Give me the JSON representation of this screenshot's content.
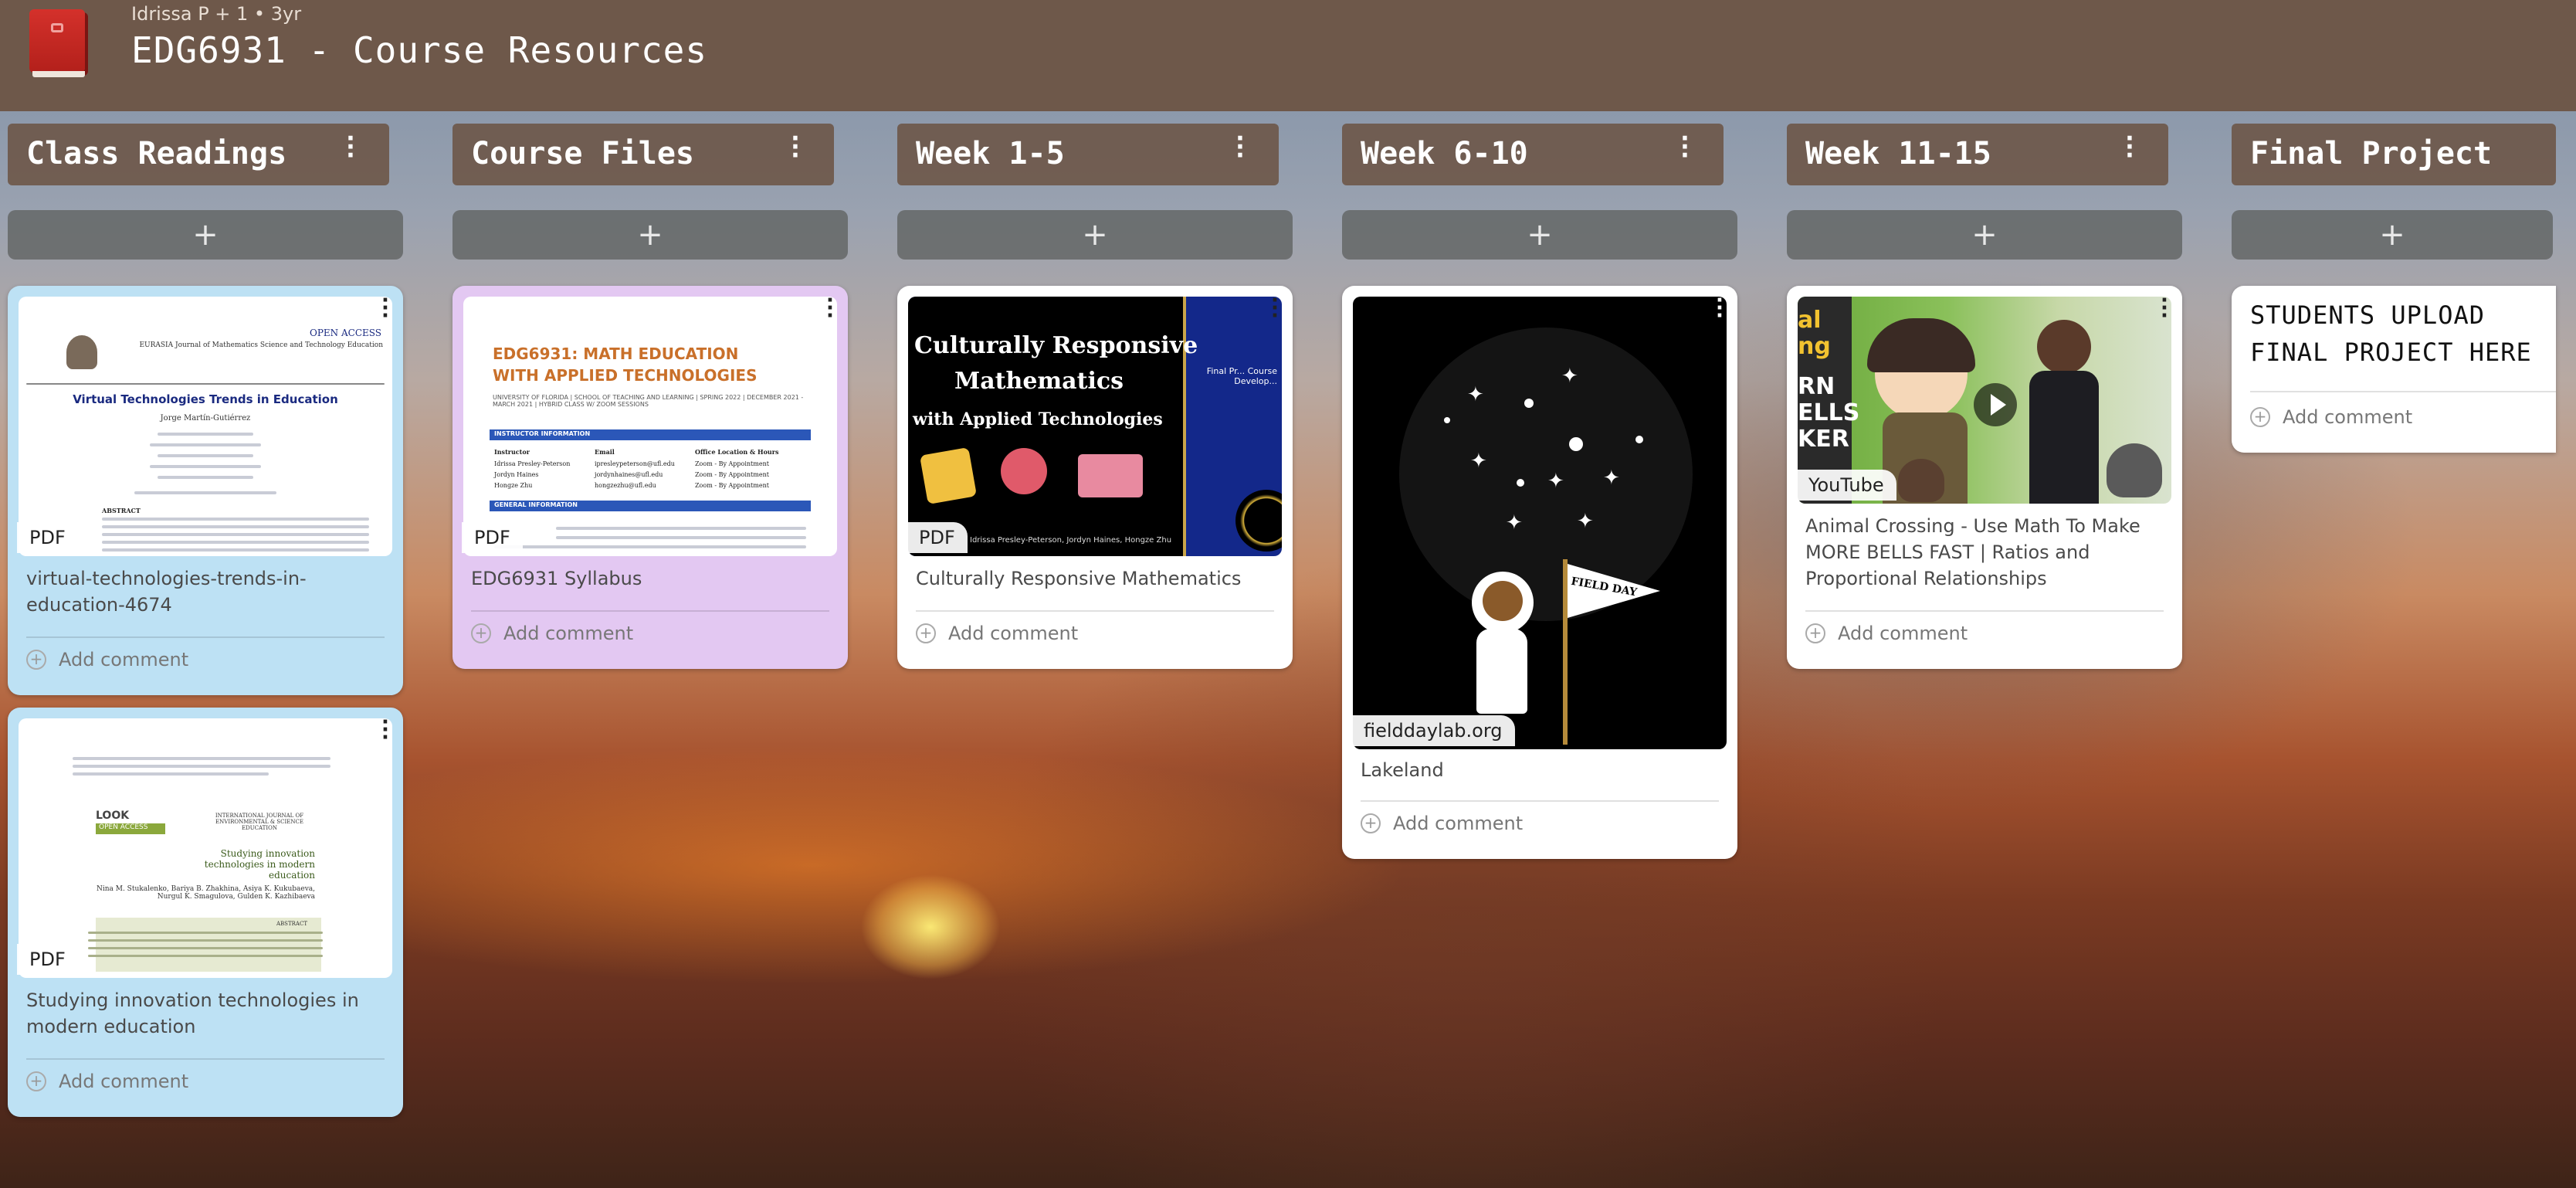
{
  "header": {
    "meta": "Idrissa P + 1 • 3yr",
    "title": "EDG6931 - Course Resources"
  },
  "icons": {
    "board": "book-icon",
    "add": "plus-icon",
    "menu": "kebab-icon",
    "comment": "add-comment-icon",
    "play": "play-icon"
  },
  "colors": {
    "header_bg": "#6e584a",
    "card_blue": "#bde1f4",
    "card_purple": "#e3c8f2",
    "card_white": "#ffffff"
  },
  "columns": [
    {
      "title": "Class Readings"
    },
    {
      "title": "Course Files"
    },
    {
      "title": "Week 1-5"
    },
    {
      "title": "Week 6-10"
    },
    {
      "title": "Week 11-15"
    },
    {
      "title": "Final Project"
    }
  ],
  "add_symbol": "+",
  "add_comment_label": "Add comment",
  "cards": {
    "readings_1": {
      "badge": "PDF",
      "title": "virtual-technologies-trends-in-education-4674",
      "doc": {
        "open_access": "OPEN ACCESS",
        "journal": "EURASIA Journal of Mathematics Science and Technology Education",
        "heading": "Virtual Technologies Trends in Education",
        "authors": "Jorge Martín-Gutiérrez",
        "abstract": "ABSTRACT"
      }
    },
    "readings_2": {
      "badge": "PDF",
      "title": "Studying innovation technologies in modern education",
      "doc": {
        "logo": "LOOK",
        "open_access": "OPEN ACCESS",
        "journal": "INTERNATIONAL JOURNAL OF ENVIRONMENTAL & SCIENCE EDUCATION",
        "heading": "Studying innovation technologies in modern education",
        "authors": "Nina M. Stukalenko, Bariya B. Zhakhina, Asiya K. Kukubaeva, Nurgul K. Smagulova, Gulden K. Kazhibaeva",
        "abstract": "ABSTRACT"
      }
    },
    "syllabus": {
      "badge": "PDF",
      "title": "EDG6931 Syllabus",
      "doc": {
        "heading1": "EDG6931: MATH EDUCATION",
        "heading2": "WITH APPLIED TECHNOLOGIES",
        "sub": "UNIVERSITY OF FLORIDA | SCHOOL OF TEACHING AND LEARNING | SPRING 2022 | DECEMBER 2021 - MARCH 2021 | HYBRID CLASS W/ ZOOM SESSIONS",
        "section1": "INSTRUCTOR INFORMATION",
        "col1": "Instructor",
        "col2": "Email",
        "col3": "Office Location & Hours",
        "rows": [
          [
            "Idrissa Presley-Peterson",
            "ipresleypeterson@ufl.edu",
            "Zoom - By Appointment"
          ],
          [
            "Jordyn Haines",
            "jordynhaines@ufl.edu",
            "Zoom - By Appointment"
          ],
          [
            "Hongze Zhu",
            "hongzezhu@ufl.edu",
            "Zoom - By Appointment"
          ]
        ],
        "section2": "GENERAL INFORMATION"
      }
    },
    "crm": {
      "badge": "PDF",
      "title": "Culturally Responsive Mathematics",
      "doc": {
        "heading1": "Culturally Responsive",
        "heading2": "Mathematics",
        "heading3": "with Applied Technologies",
        "side": "Final Pr... Course Develop...",
        "credits": "Idrissa Presley-Peterson, Jordyn Haines, Hongze Zhu"
      }
    },
    "lakeland": {
      "badge": "fielddaylab.org",
      "title": "Lakeland",
      "flag_text": "FIELD DAY"
    },
    "animal": {
      "badge": "YouTube",
      "title": "Animal Crossing - Use Math To Make MORE BELLS FAST | Ratios and Proportional Relationships",
      "thumb_text": [
        "al",
        "ng",
        "RN",
        "ELLS",
        "KER"
      ]
    },
    "final": {
      "title": "STUDENTS UPLOAD FINAL PROJECT HERE"
    }
  }
}
